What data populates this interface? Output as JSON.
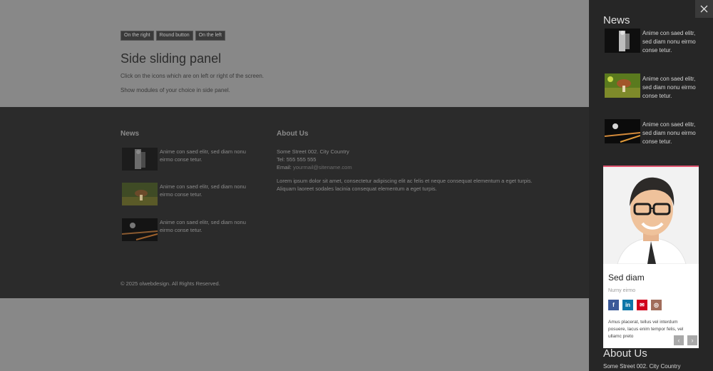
{
  "buttons": {
    "right": "On the right",
    "round": "Round button",
    "left": "On the left"
  },
  "main": {
    "title": "Side sliding panel",
    "line1": "Click on the icons which are on left or right of the screen.",
    "line2": "Show modules of your choice in side panel."
  },
  "footer": {
    "news_title": "News",
    "news": [
      {
        "text": "Anime con saed elitr, sed diam nonu eirmo conse tetur."
      },
      {
        "text": "Anime con saed elitr, sed diam nonu eirmo conse tetur."
      },
      {
        "text": "Anime con saed elitr, sed diam nonu eirmo conse tetur."
      }
    ],
    "about_title": "About Us",
    "address": "Some Street 002. City Country",
    "tel": "Tel: 555 555 555",
    "email_label": "Email:",
    "email": "yourmail@sitename.com",
    "lorem": "Lorem ipsum dolor sit amet, consectetur adipiscing elit ac felis et neque consequat elementum a eget turpis. Aliquam laoreet sodales lacinia consequat elementum a eget turpis.",
    "copyright": "© 2025 olwebdesign. All Rights Reserved."
  },
  "panel": {
    "close_icon": "close-icon",
    "news_title": "News",
    "news": [
      {
        "text": "Anime con saed elitr, sed diam nonu eirmo conse tetur."
      },
      {
        "text": "Anime con saed elitr, sed diam nonu eirmo conse tetur."
      },
      {
        "text": "Anime con saed elitr, sed diam nonu eirmo conse tetur."
      }
    ],
    "card": {
      "name": "Sed diam",
      "role": "Nurny eirmo",
      "body": "Amus placerat, tellus vel interdum posuere, lacus enim tempor felis, vel ullamc preto",
      "accent": "#e05470",
      "socials": [
        {
          "icon": "facebook-icon",
          "glyph": "f",
          "color": "#3b5998"
        },
        {
          "icon": "linkedin-icon",
          "glyph": "in",
          "color": "#0e76a8"
        },
        {
          "icon": "mail-icon",
          "glyph": "✉",
          "color": "#d0021b"
        },
        {
          "icon": "instagram-icon",
          "glyph": "◎",
          "color": "#a16d5b"
        }
      ],
      "prev": "‹",
      "next": "›"
    },
    "about_title": "About Us",
    "address": "Some Street 002. City Country"
  }
}
